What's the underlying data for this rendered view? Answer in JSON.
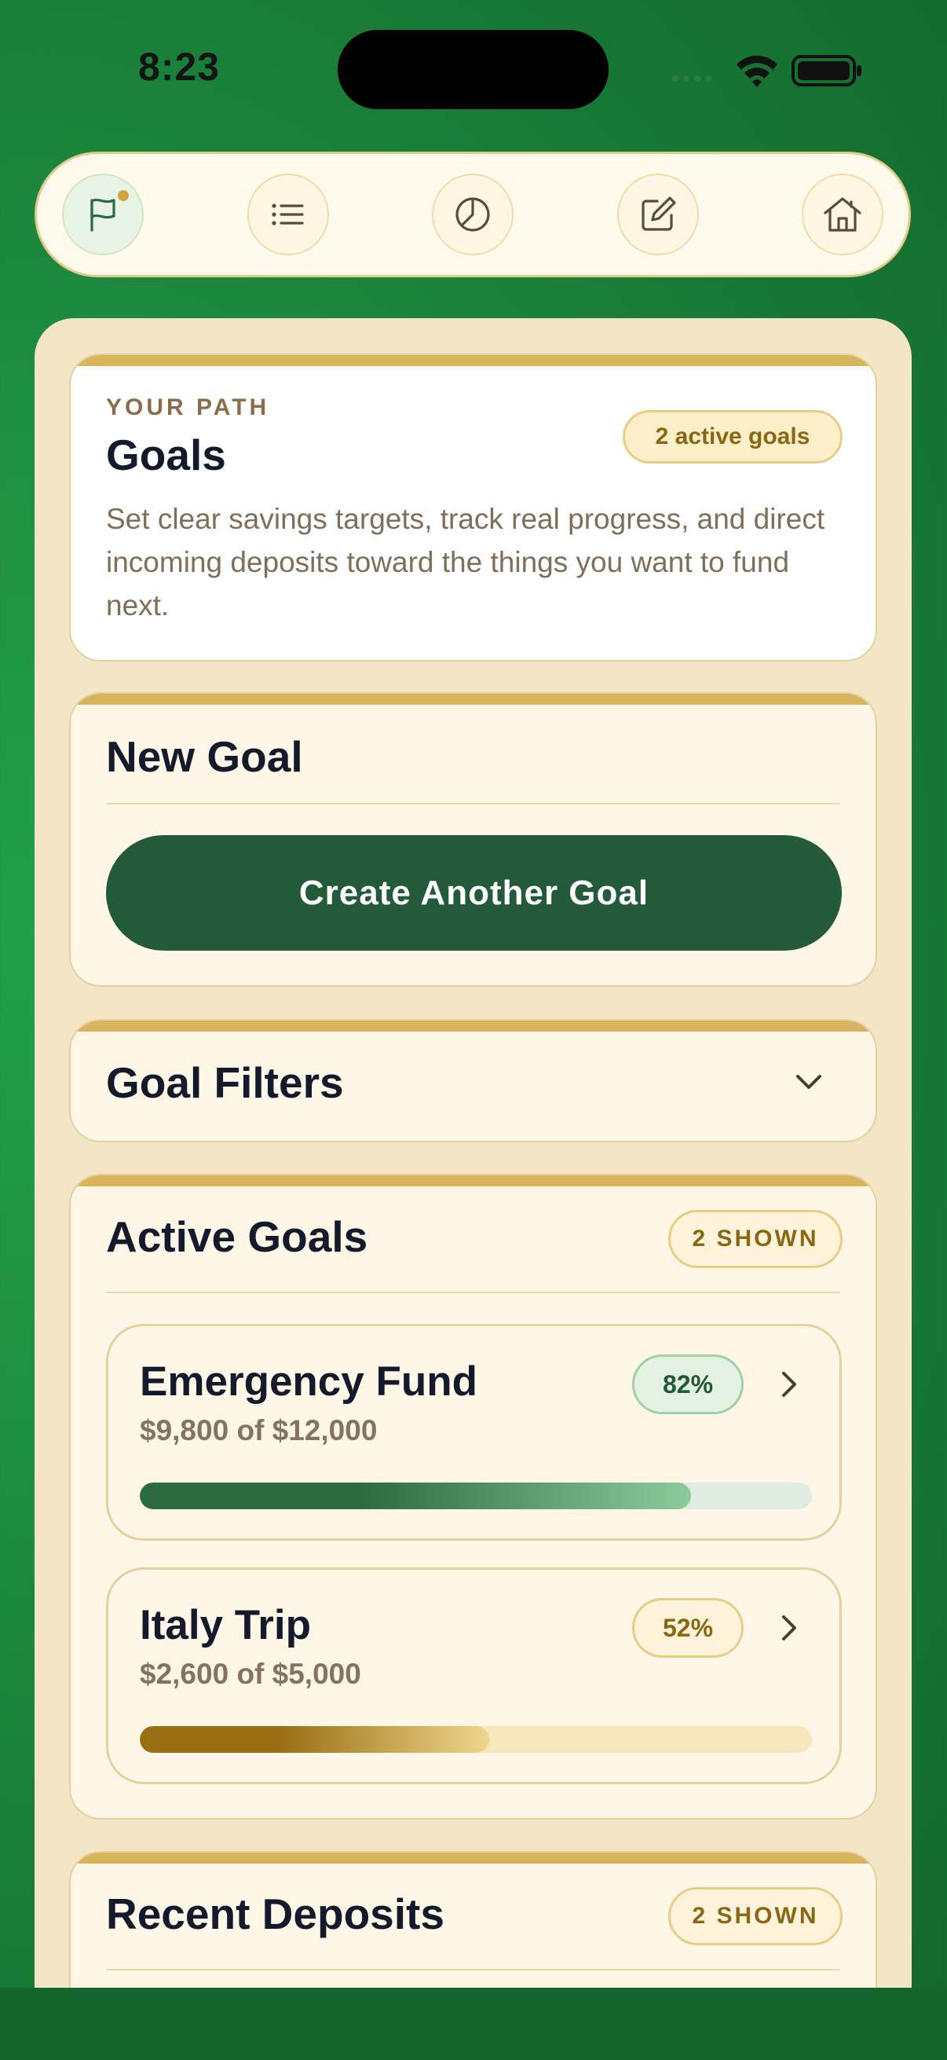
{
  "status": {
    "time": "8:23"
  },
  "nav": {
    "items": [
      {
        "icon": "flag-icon",
        "active": true
      },
      {
        "icon": "list-icon",
        "active": false
      },
      {
        "icon": "pie-chart-icon",
        "active": false
      },
      {
        "icon": "edit-icon",
        "active": false
      },
      {
        "icon": "home-icon",
        "active": false
      }
    ]
  },
  "header": {
    "eyebrow": "YOUR PATH",
    "title": "Goals",
    "badge": "2 active goals",
    "description": "Set clear savings targets, track real progress, and direct incoming deposits toward the things you want to fund next."
  },
  "new_goal": {
    "title": "New Goal",
    "button_label": "Create Another Goal"
  },
  "filters": {
    "title": "Goal Filters"
  },
  "active_goals": {
    "title": "Active Goals",
    "badge": "2 SHOWN",
    "goals": [
      {
        "name": "Emergency Fund",
        "amount": "$9,800 of $12,000",
        "percent_label": "82%",
        "progress": 0.82,
        "colors": {
          "fill_start": "#2c6a40",
          "fill_end": "#8ccb9c",
          "track": "#dfece0",
          "pill_bg": "#e4f2e4",
          "pill_border": "#9fd0a8",
          "pill_text": "#1f5a35"
        }
      },
      {
        "name": "Italy Trip",
        "amount": "$2,600 of $5,000",
        "percent_label": "52%",
        "progress": 0.52,
        "colors": {
          "fill_start": "#9a6f14",
          "fill_end": "#efd68c",
          "track": "#f6e7bd",
          "pill_bg": "#fff3dc",
          "pill_border": "#e8cd85",
          "pill_text": "#8a6712"
        }
      }
    ]
  },
  "recent_deposits": {
    "title": "Recent Deposits",
    "badge": "2 SHOWN"
  }
}
